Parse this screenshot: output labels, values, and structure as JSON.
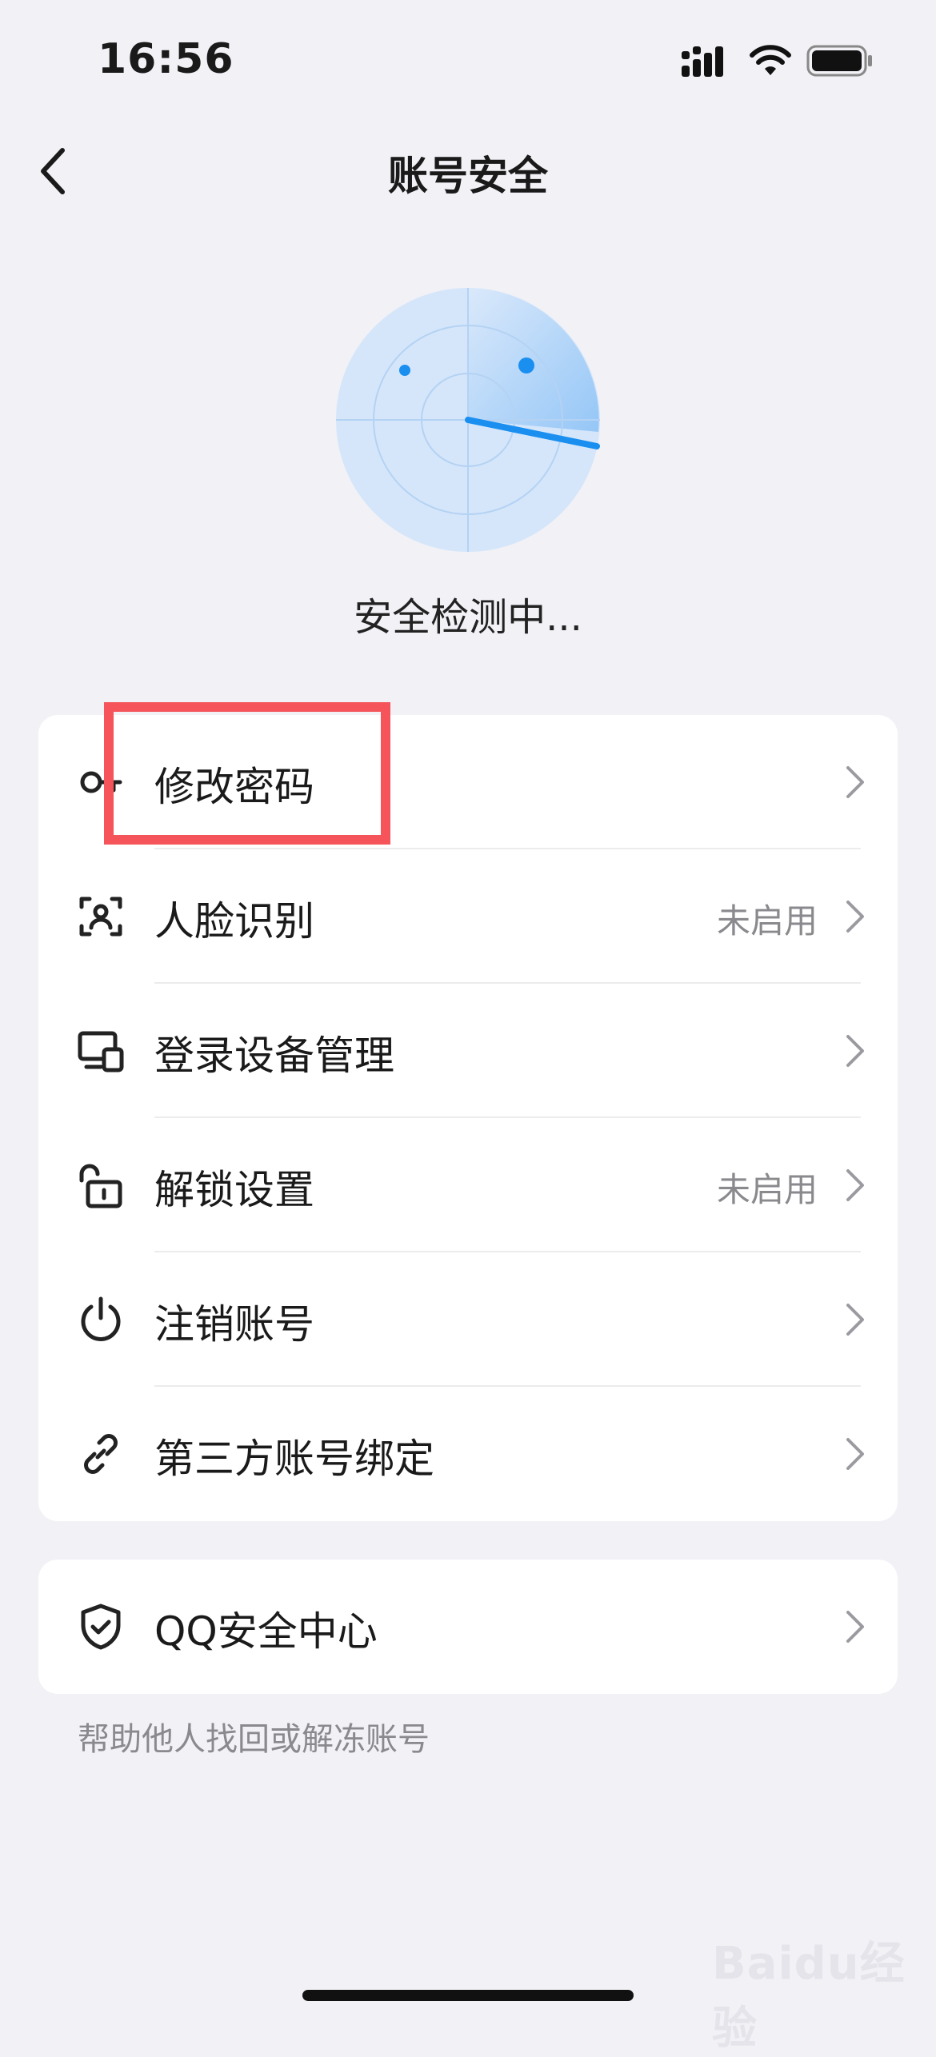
{
  "status_bar": {
    "time": "16:56"
  },
  "nav": {
    "title": "账号安全"
  },
  "scan": {
    "status": "安全检测中..."
  },
  "menu": {
    "items": [
      {
        "label": "修改密码",
        "value": "",
        "icon": "key-icon"
      },
      {
        "label": "人脸识别",
        "value": "未启用",
        "icon": "face-scan-icon"
      },
      {
        "label": "登录设备管理",
        "value": "",
        "icon": "devices-icon"
      },
      {
        "label": "解锁设置",
        "value": "未启用",
        "icon": "unlock-icon"
      },
      {
        "label": "注销账号",
        "value": "",
        "icon": "power-icon"
      },
      {
        "label": "第三方账号绑定",
        "value": "",
        "icon": "link-icon"
      }
    ]
  },
  "qq_security": {
    "label": "QQ安全中心",
    "icon": "shield-check-icon"
  },
  "helper_text": "帮助他人找回或解冻账号",
  "watermark": "Baidu经验",
  "colors": {
    "accent": "#1a8ff0",
    "highlight": "#f4545a",
    "background": "#f1f1f6"
  }
}
